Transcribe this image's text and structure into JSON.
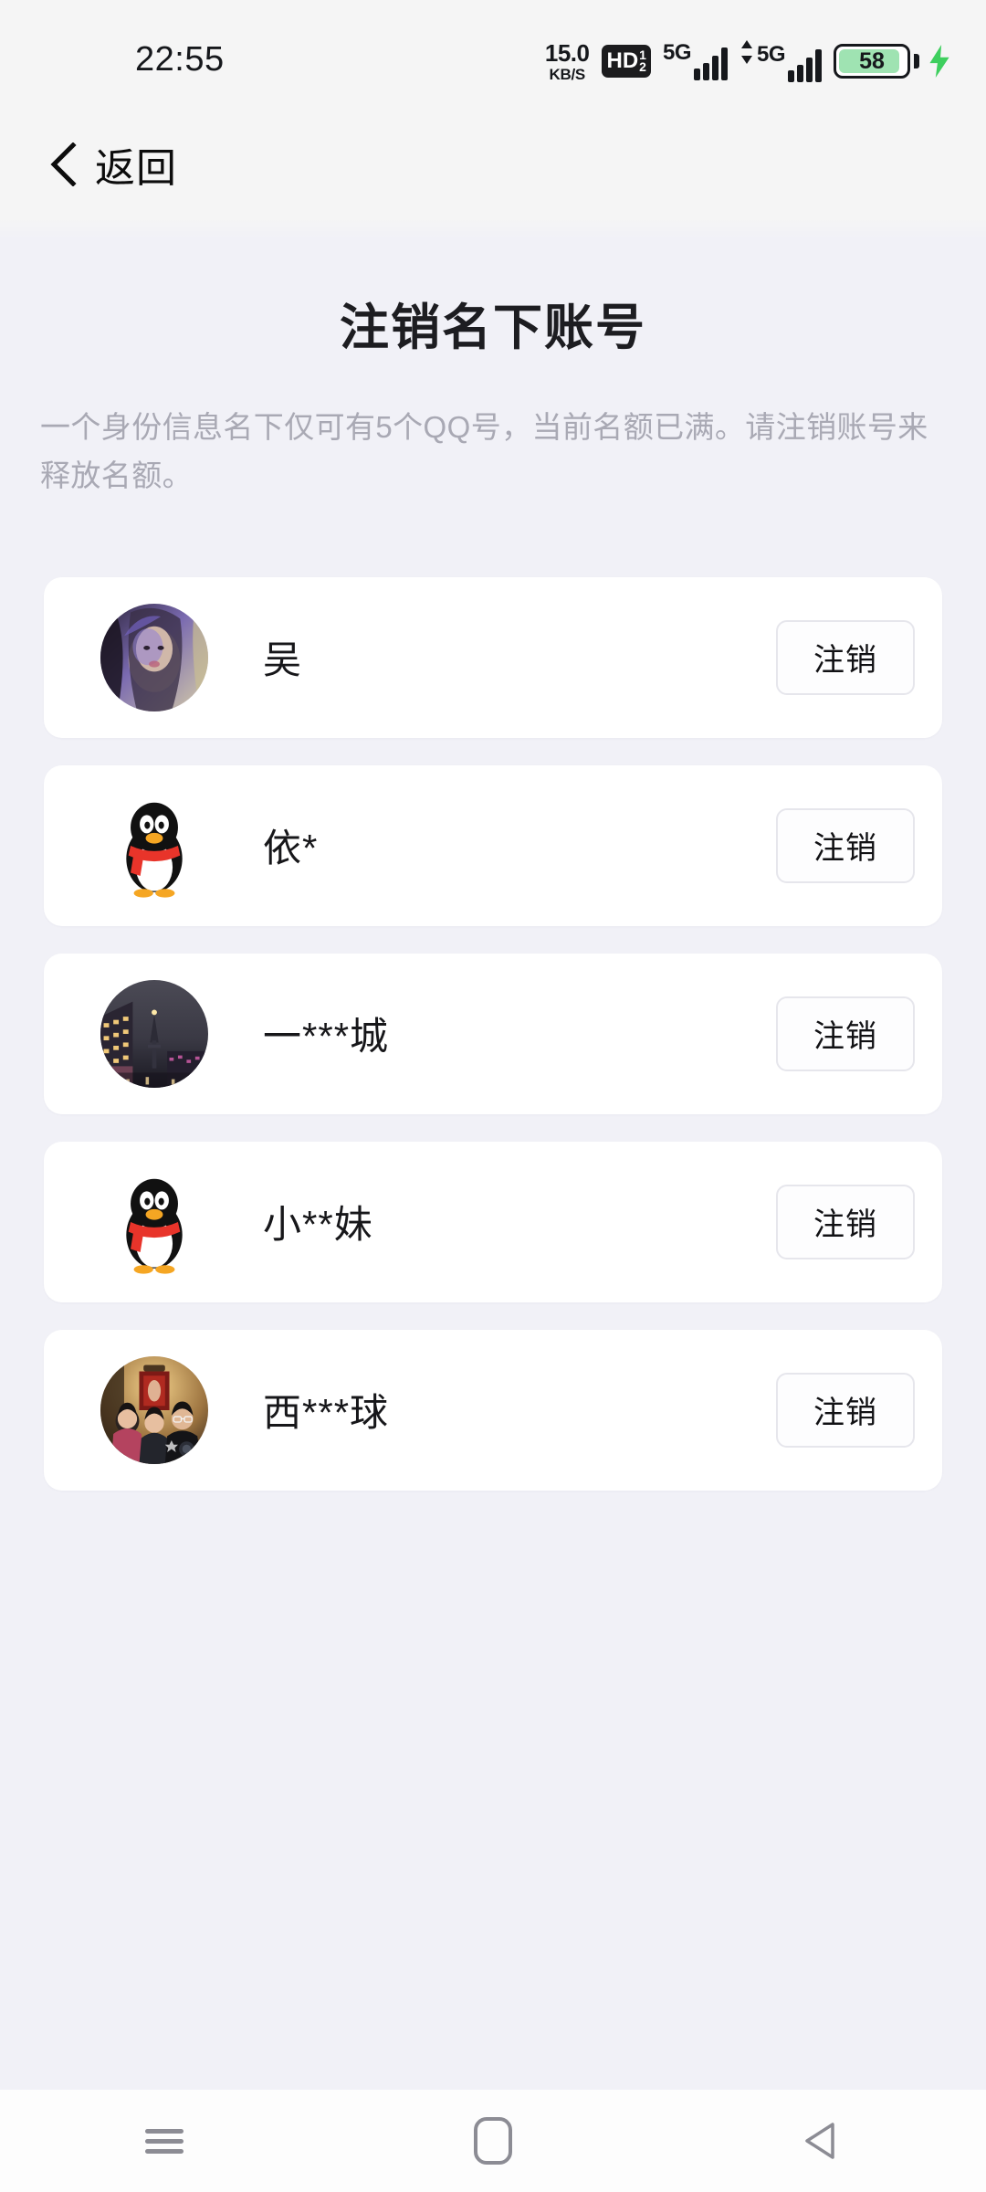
{
  "statusbar": {
    "time": "22:55",
    "net_speed_value": "15.0",
    "net_speed_unit": "KB/S",
    "hd_label": "HD",
    "hd_sup": "1",
    "hd_sub": "2",
    "sim1_network": "5G",
    "sim2_network": "5G",
    "battery_level": "58",
    "battery_fill_color": "#9fe3b2",
    "charging_bolt_color": "#3ecf5e"
  },
  "navbar": {
    "back_label": "返回"
  },
  "page": {
    "title": "注销名下账号",
    "description": "一个身份信息名下仅可有5个QQ号，当前名额已满。请注销账号来释放名额。"
  },
  "accounts": [
    {
      "name": "吴",
      "avatar_type": "photo-portrait",
      "action_label": "注销"
    },
    {
      "name": "依*",
      "avatar_type": "qq-penguin",
      "action_label": "注销"
    },
    {
      "name": "一***城",
      "avatar_type": "photo-cityscape",
      "action_label": "注销"
    },
    {
      "name": "小**妹",
      "avatar_type": "qq-penguin",
      "action_label": "注销"
    },
    {
      "name": "西***球",
      "avatar_type": "photo-group",
      "action_label": "注销"
    }
  ],
  "system_nav": {
    "recents_label": "最近任务",
    "home_label": "主页",
    "back_label": "返回"
  },
  "colors": {
    "page_background": "#f1f1f7",
    "header_background": "#f5f5f5",
    "card_background": "#ffffff",
    "title_text": "#1d1d21",
    "desc_text": "#a9a9b4",
    "button_border": "#e6e6ec"
  }
}
